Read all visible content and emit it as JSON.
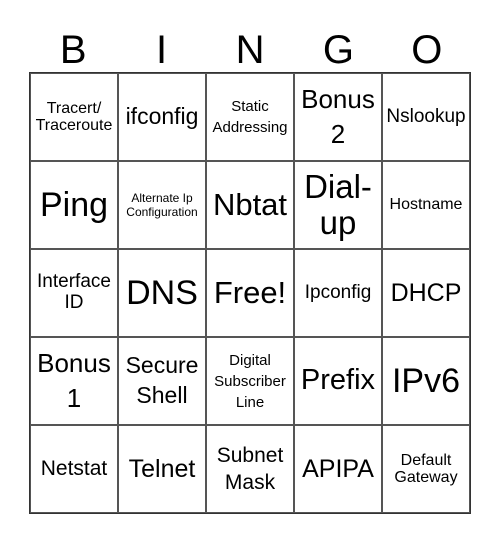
{
  "header": [
    "B",
    "I",
    "N",
    "G",
    "O"
  ],
  "cells": [
    [
      "Tracert/ Traceroute",
      "ifconfig",
      "Static Addressing",
      "Bonus 2",
      "Nslookup"
    ],
    [
      "Ping",
      "Alternate Ip Configuration",
      "Nbtat",
      "Dial- up",
      "Hostname"
    ],
    [
      "Interface ID",
      "DNS",
      "Free!",
      "Ipconfig",
      "DHCP"
    ],
    [
      "Bonus 1",
      "Secure Shell",
      "Digital Subscriber Line",
      "Prefix",
      "IPv6"
    ],
    [
      "Netstat",
      "Telnet",
      "Subnet Mask",
      "APIPA",
      "Default Gateway"
    ]
  ]
}
